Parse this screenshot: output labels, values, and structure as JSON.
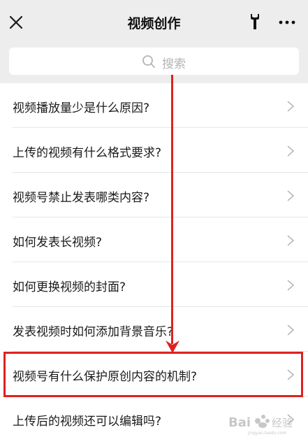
{
  "header": {
    "title": "视频创作",
    "close_icon": "close-icon",
    "tool_icon": "wrench-icon",
    "more_icon": "more-icon"
  },
  "search": {
    "placeholder": "搜索",
    "icon": "search-icon"
  },
  "list": {
    "items": [
      {
        "label": "视频播放量少是什么原因?"
      },
      {
        "label": "上传的视频有什么格式要求?"
      },
      {
        "label": "视频号禁止发表哪类内容?"
      },
      {
        "label": "如何发表长视频?"
      },
      {
        "label": "如何更换视频的封面?"
      },
      {
        "label": "发表视频时如何添加背景音乐?"
      },
      {
        "label": "视频号有什么保护原创内容的机制?"
      },
      {
        "label": "上传后的视频还可以编辑吗?"
      }
    ]
  },
  "annotation": {
    "color": "#e02020"
  },
  "watermark": {
    "text": "Bai 经验"
  }
}
